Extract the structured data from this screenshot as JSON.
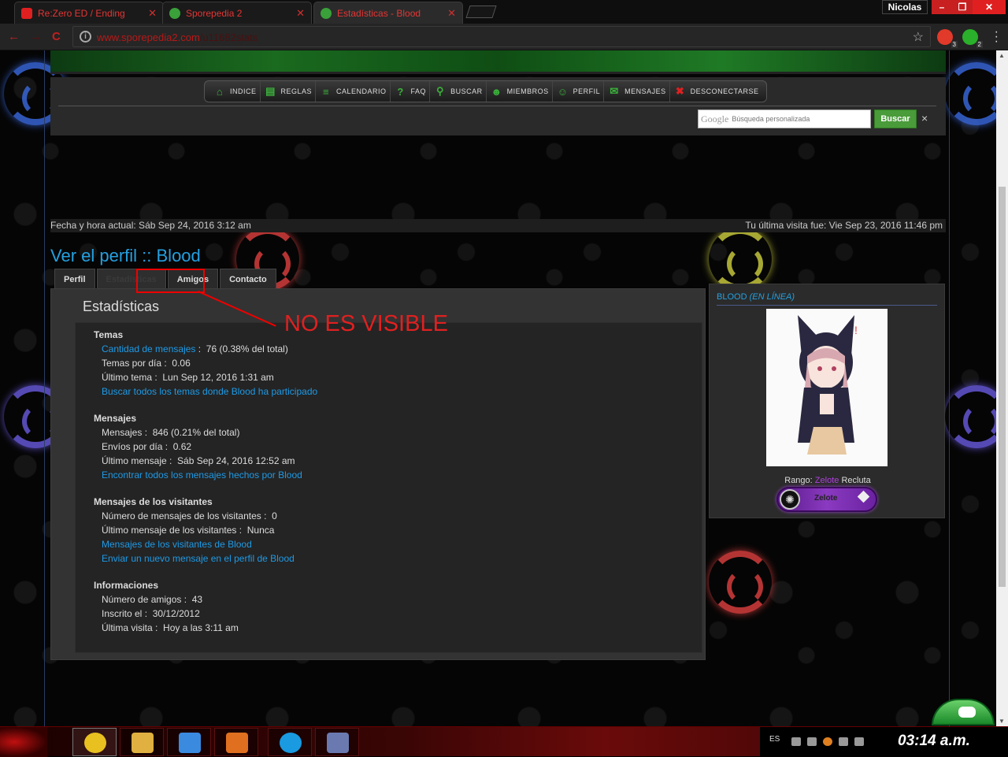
{
  "browser": {
    "tabs": [
      {
        "title": "Re:Zero ED / Ending",
        "icon": "youtube-icon",
        "color": "#e02020"
      },
      {
        "title": "Sporepedia 2",
        "icon": "sporepedia-icon",
        "color": "#3aa03a"
      },
      {
        "title": "Estadísticas - Blood",
        "icon": "sporepedia-icon",
        "color": "#3aa03a"
      }
    ],
    "profile_name": "Nicolas",
    "window_controls": {
      "minimize": "–",
      "maximize": "❐",
      "close": "✕"
    },
    "nav": {
      "back": "←",
      "forward": "→",
      "reload": "C"
    },
    "url": {
      "domain": "www.sporepedia2.com",
      "path": "/u11682stats"
    },
    "extensions": [
      {
        "badge": "3",
        "color": "#e23a2a"
      },
      {
        "badge": "2",
        "color": "#2ab02a"
      }
    ]
  },
  "site": {
    "navbar": [
      {
        "label": "INDICE",
        "icon": "home-icon",
        "color": "#3ab03a",
        "glyph": "⌂"
      },
      {
        "label": "REGLAS",
        "icon": "book-icon",
        "color": "#3ab03a",
        "glyph": "▤"
      },
      {
        "label": "CALENDARIO",
        "icon": "calendar-icon",
        "color": "#3ab03a",
        "glyph": "≡"
      },
      {
        "label": "FAQ",
        "icon": "question-icon",
        "color": "#3ab03a",
        "glyph": "?"
      },
      {
        "label": "BUSCAR",
        "icon": "search-icon",
        "color": "#3ab03a",
        "glyph": "⚲"
      },
      {
        "label": "MIEMBROS",
        "icon": "members-icon",
        "color": "#3ab03a",
        "glyph": "☻"
      },
      {
        "label": "PERFIL",
        "icon": "user-icon",
        "color": "#3ab03a",
        "glyph": "☺"
      },
      {
        "label": "MENSAJES",
        "icon": "mail-icon",
        "color": "#3ab03a",
        "glyph": "✉"
      },
      {
        "label": "DESCONECTARSE",
        "icon": "logout-icon",
        "color": "#e02020",
        "glyph": "✖"
      }
    ],
    "search": {
      "logo": "Google",
      "placeholder": "Búsqueda personalizada",
      "button": "Buscar",
      "close": "×"
    },
    "current_date": "Fecha y hora actual: Sáb Sep 24, 2016 3:12 am",
    "last_visit": "Tu última visita fue: Vie Sep 23, 2016 11:46 pm"
  },
  "profile": {
    "title": "Ver el perfil :: Blood",
    "tabs": [
      "Perfil",
      "Estadísticas",
      "Amigos",
      "Contacto"
    ],
    "annotation": "NO ES VISIBLE",
    "section_title": "Estadísticas",
    "temas": {
      "title": "Temas",
      "count_label": "Cantidad de mensajes",
      "count_value": "76 (0.38% del total)",
      "per_day_label": "Temas por día",
      "per_day_value": "0.06",
      "last_label": "Último tema",
      "last_value": "Lun Sep 12, 2016 1:31 am",
      "link": "Buscar todos los temas donde Blood ha participado"
    },
    "mensajes": {
      "title": "Mensajes",
      "count_label": "Mensajes",
      "count_value": "846 (0.21% del total)",
      "per_day_label": "Envíos por día",
      "per_day_value": "0.62",
      "last_label": "Último mensaje",
      "last_value": "Sáb Sep 24, 2016 12:52 am",
      "link": "Encontrar todos los mensajes hechos por Blood"
    },
    "visitantes": {
      "title": "Mensajes de los visitantes",
      "count_label": "Número de mensajes de los visitantes",
      "count_value": "0",
      "last_label": "Último mensaje de los visitantes",
      "last_value": "Nunca",
      "link1": "Mensajes de los visitantes de Blood",
      "link2": "Enviar un nuevo mensaje en el perfil de Blood"
    },
    "informaciones": {
      "title": "Informaciones",
      "friends_label": "Número de amigos",
      "friends_value": "43",
      "joined_label": "Inscrito el",
      "joined_value": "30/12/2012",
      "last_label": "Última visita",
      "last_value": "Hoy a las 3:11 am"
    },
    "side": {
      "name": "BLOOD",
      "status": "(EN LÍNEA)",
      "rank_label": "Rango:",
      "rank_name": "Zelote",
      "rank_suffix": "Recluta",
      "badge_label": "Zelote"
    }
  },
  "taskbar": {
    "apps": [
      {
        "name": "chrome",
        "color": "#e8c020"
      },
      {
        "name": "file-explorer",
        "color": "#e0b040"
      },
      {
        "name": "media-player",
        "color": "#3a8ae0"
      },
      {
        "name": "microphone",
        "color": "#e07020"
      },
      {
        "name": "skype",
        "color": "#1a9ae0"
      },
      {
        "name": "app",
        "color": "#6a7ab0"
      }
    ],
    "language": "ES",
    "clock": "03:14 a.m."
  }
}
